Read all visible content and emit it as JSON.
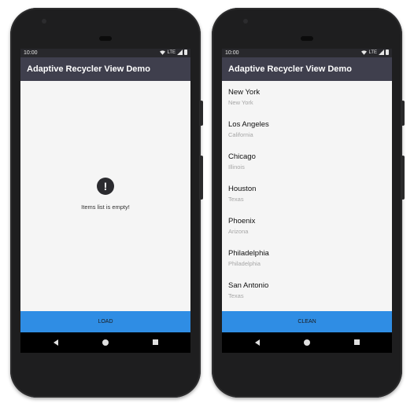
{
  "left_phone": {
    "status_time": "10:00",
    "status_network": "LTE",
    "app_title": "Adaptive Recycler View Demo",
    "empty_icon": "exclamation-circle-icon",
    "empty_glyph": "!",
    "empty_message": "Items list is empty!",
    "button_label": "LOAD"
  },
  "right_phone": {
    "status_time": "10:00",
    "status_network": "LTE",
    "app_title": "Adaptive Recycler View Demo",
    "items": [
      {
        "title": "New York",
        "subtitle": "New York"
      },
      {
        "title": "Los Angeles",
        "subtitle": "California"
      },
      {
        "title": "Chicago",
        "subtitle": "Illinois"
      },
      {
        "title": "Houston",
        "subtitle": "Texas"
      },
      {
        "title": "Phoenix",
        "subtitle": "Arizona"
      },
      {
        "title": "Philadelphia",
        "subtitle": "Philadelphia"
      },
      {
        "title": "San Antonio",
        "subtitle": "Texas"
      }
    ],
    "button_label": "CLEAN"
  },
  "colors": {
    "app_bar": "#3f3f4d",
    "action_button": "#2f8de4",
    "screen_background": "#f5f5f5"
  }
}
